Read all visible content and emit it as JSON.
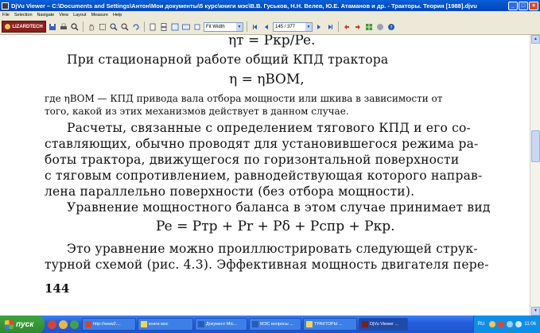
{
  "window": {
    "title": "DjVu Viewer – C:\\Documents and Settings\\Антон\\Мои документы\\5 курс\\книги мэс\\В.В. Гуськов, Н.Н. Велев, Ю.Е. Атаманов и др. - Тракторы. Теория [1988].djvu",
    "minimize_label": "_",
    "maximize_label": "□",
    "close_label": "×"
  },
  "menu": [
    "File",
    "Selection",
    "Navigate",
    "View",
    "Layout",
    "Measure",
    "Help"
  ],
  "toolbar": {
    "logo_text": "LIZARDTECH",
    "zoom_value": "Fit Width",
    "page_indicator": "145 / 377"
  },
  "document": {
    "line1": "ηт = Pкр/Pe.",
    "line2": "При стационарной работе общий КПД трактора",
    "line3": "η = ηВОМ,",
    "note1": "где ηВОМ — КПД привода вала отбора мощности или шкива в зависимости от",
    "note2": "того, какой из этих механизмов действует в данном случае.",
    "para1": [
      "Расчеты, связанные с определением тягового КПД и его со-",
      "ставляющих, обычно проводят для установившегося режима ра-",
      "боты трактора, движущегося по горизонтальной поверхности",
      "с тяговым сопротивлением, равнодействующая которого направ-",
      "лена параллельно поверхности (без отбора мощности)."
    ],
    "para2": "Уравнение мощностного баланса в этом случае принимает вид",
    "formula": "Pe = Pтр + Pr + Pδ + Pспр + Pкр.",
    "para3": [
      "Это уравнение можно проиллюстрировать следующей струк-",
      "турной схемой (рис. 4.3). Эффективная мощность двигателя пере-"
    ],
    "page_number": "144"
  },
  "taskbar": {
    "start_label": "пуск",
    "tasks": [
      {
        "label": "http://www2...."
      },
      {
        "label": "книги мэс"
      },
      {
        "label": "Документ Mic..."
      },
      {
        "label": "МЭС вопросы ..."
      },
      {
        "label": "ТРАКТОРЫ ..."
      },
      {
        "label": "DjVu Viewer ..."
      }
    ],
    "language": "RU",
    "clock": "11:06"
  },
  "colors": {
    "titlebar": "#0a5fd8",
    "taskbar": "#245edb",
    "start_button": "#3fa33f",
    "tray": "#0f8ee8",
    "toolbar_bg": "#ece9d8"
  }
}
